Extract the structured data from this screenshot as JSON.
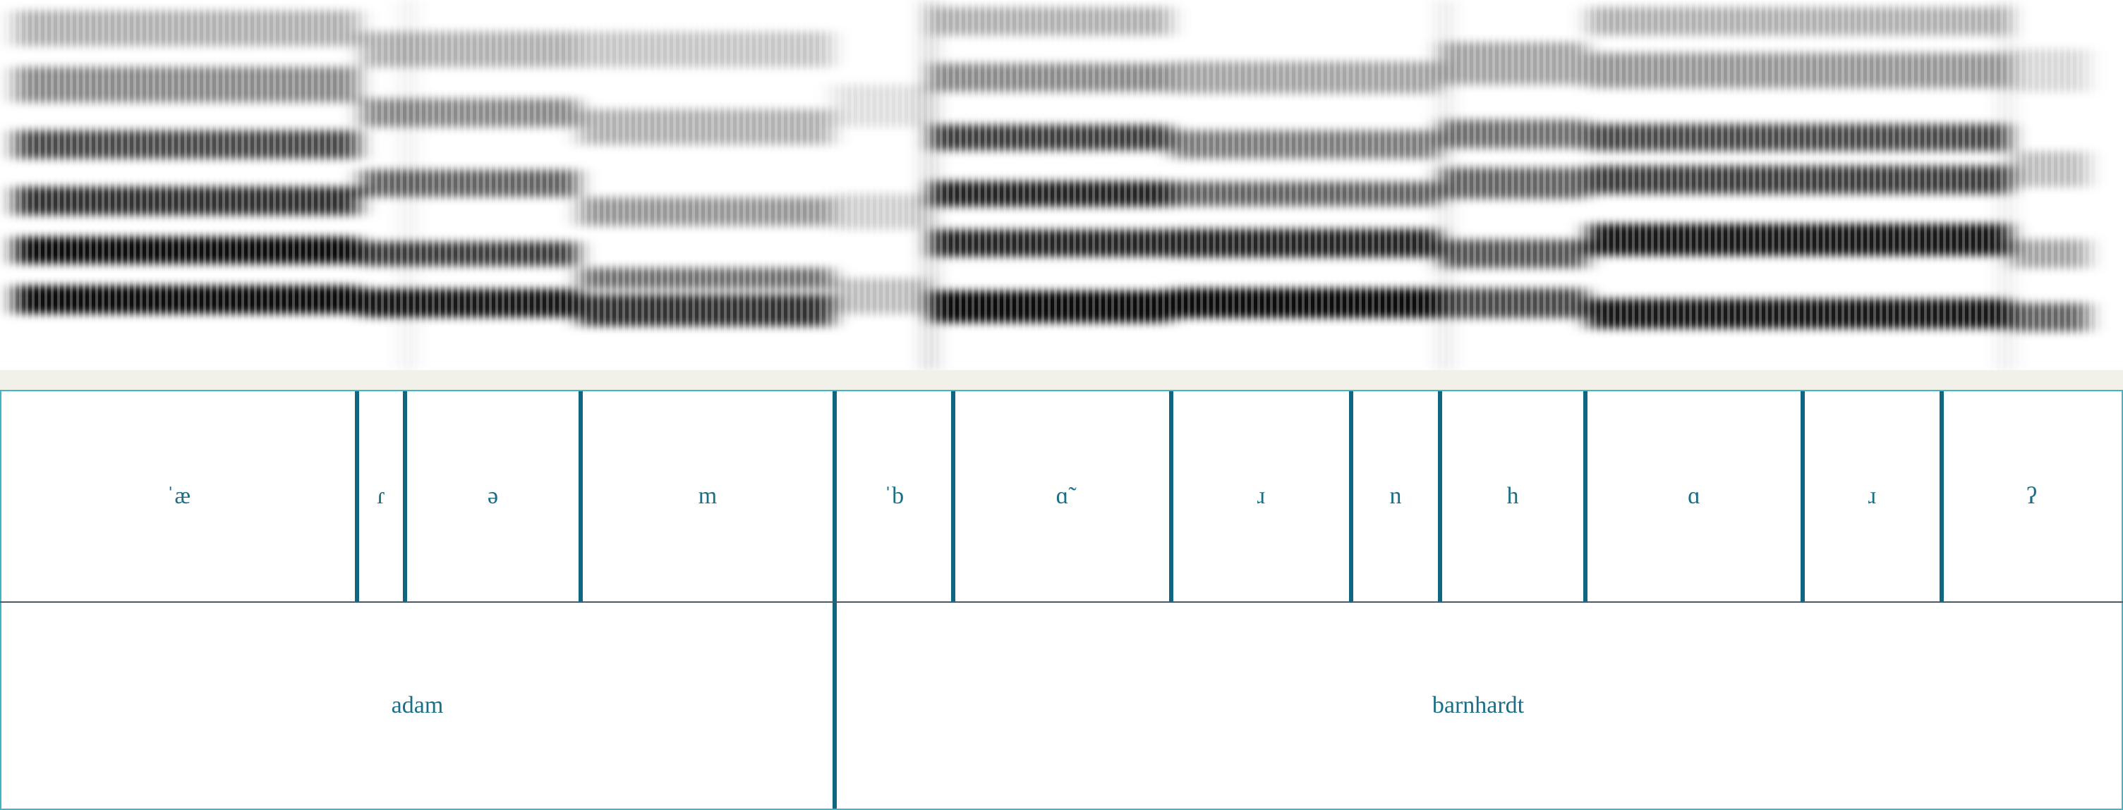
{
  "colors": {
    "label_text": "#1a6f86",
    "boundary": "#0f6680",
    "separator_bg": "#f1f1e9",
    "tier_edge": "#3fb6c8"
  },
  "phone_tier": {
    "intervals": [
      {
        "label": "ˈæ"
      },
      {
        "label": "ɾ"
      },
      {
        "label": "ə"
      },
      {
        "label": "m"
      },
      {
        "label": "ˈb"
      },
      {
        "label": "ɑ̃"
      },
      {
        "label": "ɹ"
      },
      {
        "label": "n"
      },
      {
        "label": "h"
      },
      {
        "label": "ɑ"
      },
      {
        "label": "ɹ"
      },
      {
        "label": "ʔ"
      }
    ]
  },
  "word_tier": {
    "intervals": [
      {
        "label": "adam"
      },
      {
        "label": "barnhardt"
      }
    ]
  }
}
